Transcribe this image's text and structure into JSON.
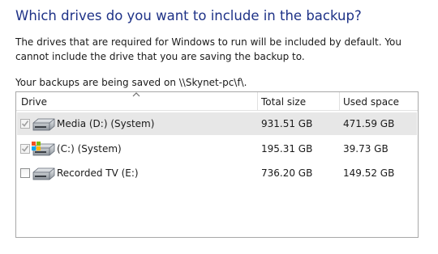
{
  "heading": "Which drives do you want to include in the backup?",
  "description": "The drives that are required for Windows to run will be included by default. You cannot include the drive that you are saving the backup to.",
  "saving_location": "Your backups are being saved on \\\\Skynet-pc\\f\\.",
  "table": {
    "columns": [
      "Drive",
      "Total size",
      "Used space"
    ],
    "sort_column": "Drive",
    "rows": [
      {
        "name": "Media (D:) (System)",
        "total": "931.51 GB",
        "used": "471.59 GB",
        "checked": true,
        "disabled": true,
        "selected": true,
        "icon": "hard-drive-icon"
      },
      {
        "name": "(C:) (System)",
        "total": "195.31 GB",
        "used": "39.73 GB",
        "checked": true,
        "disabled": true,
        "selected": false,
        "icon": "windows-system-drive-icon"
      },
      {
        "name": "Recorded TV (E:)",
        "total": "736.20 GB",
        "used": "149.52 GB",
        "checked": false,
        "disabled": false,
        "selected": false,
        "icon": "hard-drive-icon"
      }
    ]
  },
  "colors": {
    "heading": "#1e3287",
    "selected_row": "#e7e7e7",
    "checkmark_disabled": "#a0a0a0"
  }
}
